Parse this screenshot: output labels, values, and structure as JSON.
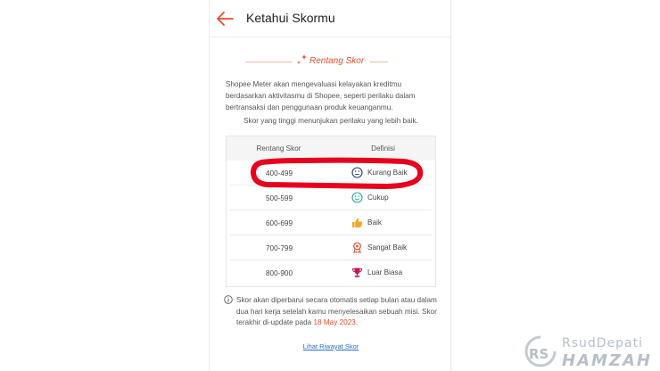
{
  "header": {
    "title": "Ketahui Skormu"
  },
  "section": {
    "title": "Rentang Skor"
  },
  "description": "Shopee Meter akan mengevaluasi kelayakan kreditmu berdasarkan aktivitasmu di Shopee, seperti perilaku dalam bertransaksi dan penggunaan produk keuanganmu.",
  "subdescription": "Skor yang tinggi menunjukan perilaku yang lebih baik.",
  "table": {
    "headers": [
      "Rentang Skor",
      "Definisi"
    ],
    "rows": [
      {
        "range": "400-499",
        "definition": "Kurang Baik",
        "icon": "sad-face-icon",
        "color": "#1f3d8a"
      },
      {
        "range": "500-599",
        "definition": "Cukup",
        "icon": "smile-face-icon",
        "color": "#26aa99"
      },
      {
        "range": "600-699",
        "definition": "Baik",
        "icon": "thumbs-up-icon",
        "color": "#f6a623"
      },
      {
        "range": "700-799",
        "definition": "Sangat Baik",
        "icon": "medal-icon",
        "color": "#ee4d2d"
      },
      {
        "range": "800-900",
        "definition": "Luar Biasa",
        "icon": "trophy-icon",
        "color": "#c2185b"
      }
    ]
  },
  "note": {
    "text": "Skor akan diperbarui secara otomatis setiap bulan atau dalam dua hari kerja setelah kamu menyelesaikan sebuah misi. Skor terakhir di-update pada ",
    "date": "18 May 2023",
    "suffix": "."
  },
  "link": {
    "label": "Lihat Riwayat Skor"
  },
  "watermark": {
    "line1": "RsudDepati",
    "line2": "HAMZAH",
    "logo": "RS"
  },
  "colors": {
    "accent": "#ee4d2d",
    "highlight": "#e8001c",
    "link": "#2a6fc9"
  }
}
